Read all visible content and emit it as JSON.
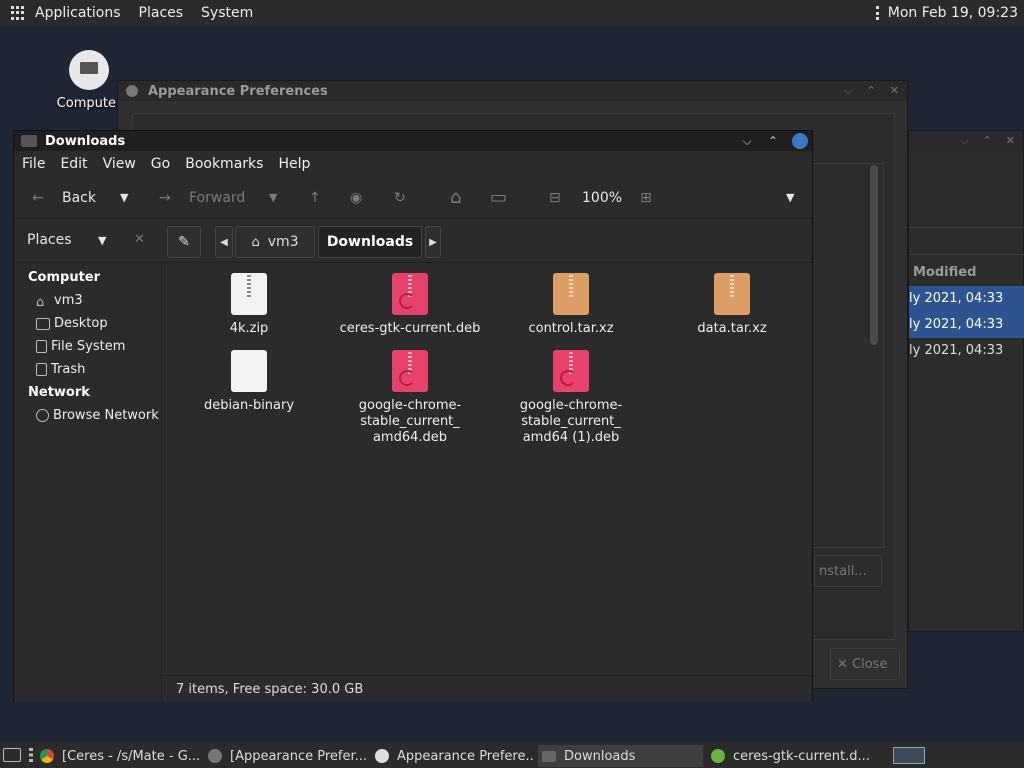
{
  "top_panel": {
    "menus": [
      "Applications",
      "Places",
      "System"
    ],
    "clock": "Mon Feb 19, 09:23"
  },
  "desktop": {
    "computer_label": "Computer"
  },
  "appearance_window": {
    "title": "Appearance Preferences",
    "install_label": "nstall...",
    "close_label": "✕ Close"
  },
  "package_window": {
    "column_header": "Modified",
    "rows": [
      "ly 2021, 04:33",
      "ly 2021, 04:33",
      "ly 2021, 04:33"
    ]
  },
  "downloads_window": {
    "title": "Downloads",
    "menu": [
      "File",
      "Edit",
      "View",
      "Go",
      "Bookmarks",
      "Help"
    ],
    "toolbar": {
      "back": "Back",
      "forward": "Forward",
      "zoom": "100%"
    },
    "sidebar_mode": "Places",
    "path": [
      "vm3",
      "Downloads"
    ],
    "sidebar": {
      "computer_header": "Computer",
      "computer_items": [
        "vm3",
        "Desktop",
        "File System",
        "Trash"
      ],
      "network_header": "Network",
      "network_items": [
        "Browse Network"
      ]
    },
    "files": [
      {
        "name": "4k.zip",
        "type": "zip"
      },
      {
        "name": "ceres-gtk-current.deb",
        "type": "deb"
      },
      {
        "name": "control.tar.xz",
        "type": "tar"
      },
      {
        "name": "data.tar.xz",
        "type": "tar"
      },
      {
        "name": "debian-binary",
        "type": "bin"
      },
      {
        "name": "google-chrome-stable_current_amd64.deb",
        "type": "deb",
        "lines": [
          "google-chrome-",
          "stable_current_",
          "amd64.deb"
        ]
      },
      {
        "name": "google-chrome-stable_current_amd64 (1).deb",
        "type": "deb",
        "lines": [
          "google-chrome-",
          "stable_current_",
          "amd64 (1).deb"
        ]
      }
    ],
    "status": "7 items, Free space: 30.0 GB"
  },
  "taskbar": {
    "tasks": [
      "[Ceres - /s/Mate - G...",
      "[Appearance Prefer...",
      "Appearance Prefere...",
      "Downloads",
      "ceres-gtk-current.d..."
    ]
  }
}
